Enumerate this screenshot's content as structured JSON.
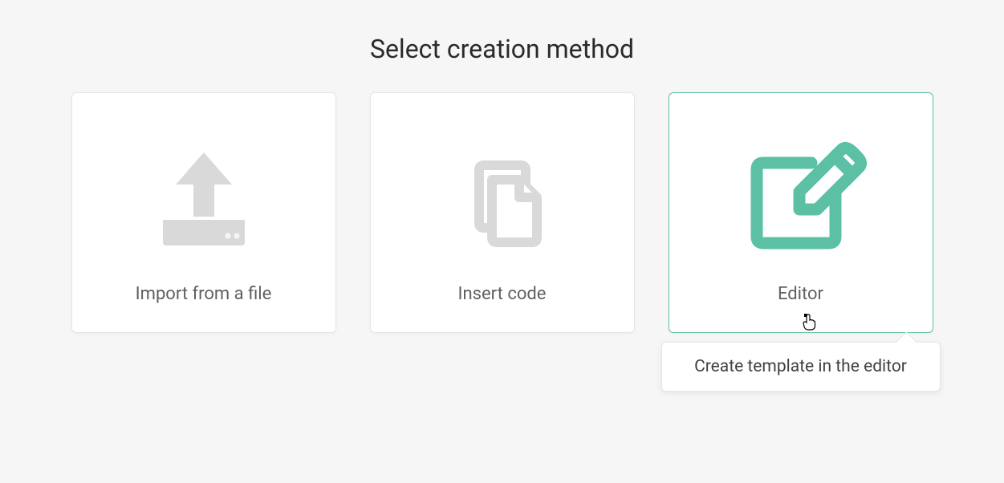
{
  "title": "Select creation method",
  "cards": [
    {
      "label": "Import from a file"
    },
    {
      "label": "Insert code"
    },
    {
      "label": "Editor"
    }
  ],
  "tooltip": "Create template in the editor",
  "colors": {
    "accent": "#5cc0a5",
    "iconMuted": "#d9d9d9"
  }
}
